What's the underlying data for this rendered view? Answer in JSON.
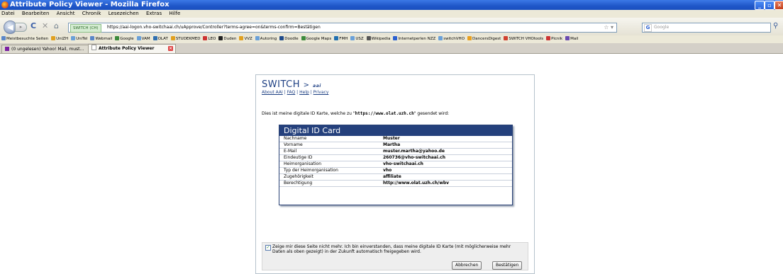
{
  "window": {
    "title": "Attribute Policy Viewer - Mozilla Firefox"
  },
  "menu": [
    "Datei",
    "Bearbeiten",
    "Ansicht",
    "Chronik",
    "Lesezeichen",
    "Extras",
    "Hilfe"
  ],
  "nav": {
    "url_badge": "SWITCH (CH)",
    "url": "https://aai-logon.vho-switchaai.ch/uApprove/Controller?terms-agree=on&terms-confirm=Bestätigen",
    "search_placeholder": "Google"
  },
  "bookmarks": [
    "Meistbesuchte Seiten",
    "UniZH",
    "UniTel",
    "Webmail",
    "Google",
    "VAM",
    "OLAT",
    "STUDEKMED",
    "LEO",
    "Duden",
    "VVZ",
    "Autoring",
    "Doodle",
    "Google Maps",
    "FMH",
    "USZ",
    "Wikipedia",
    "Internetperlen NZZ",
    "switchVHO",
    "DancersDigest",
    "SWITCH VHOtools",
    "Picnik",
    "Mail"
  ],
  "tabs": [
    {
      "label": "(0 ungelesen) Yahoo! Mail, must..."
    },
    {
      "label": "Attribute Policy Viewer"
    }
  ],
  "page": {
    "brand": "SWITCH",
    "brand_sub": "aai",
    "links": [
      "About AAI",
      "FAQ",
      "Help",
      "Privacy"
    ],
    "intro_before": "Dies ist meine digitale ID Karte, welche zu \"",
    "intro_url": "https://www.olat.uzh.ch",
    "intro_after": "\" gesendet wird:",
    "card_title": "Digital ID Card",
    "attributes": [
      {
        "key": "Nachname",
        "value": "Muster"
      },
      {
        "key": "Vorname",
        "value": "Martha"
      },
      {
        "key": "E-Mail",
        "value": "muster.martha@yahoo.de"
      },
      {
        "key": "Eindeutige ID",
        "value": "260736@vho-switchaai.ch"
      },
      {
        "key": "Heimorganisation",
        "value": "vho-switchaai.ch"
      },
      {
        "key": "Typ der Heimorganisation",
        "value": "vho"
      },
      {
        "key": "Zugehörigkeit",
        "value": "affiliate"
      },
      {
        "key": "Berechtigung",
        "value": "http://www.olat.uzh.ch/wbv"
      }
    ],
    "consent_text": "Zeige mir diese Seite nicht mehr. Ich bin einverstanden, dass meine digitale ID Karte (mit möglicherweise mehr Daten als oben gezeigt) in der Zukunft automatisch freigegeben wird.",
    "consent_checked": true,
    "cancel_label": "Abbrechen",
    "confirm_label": "Bestätigen"
  }
}
